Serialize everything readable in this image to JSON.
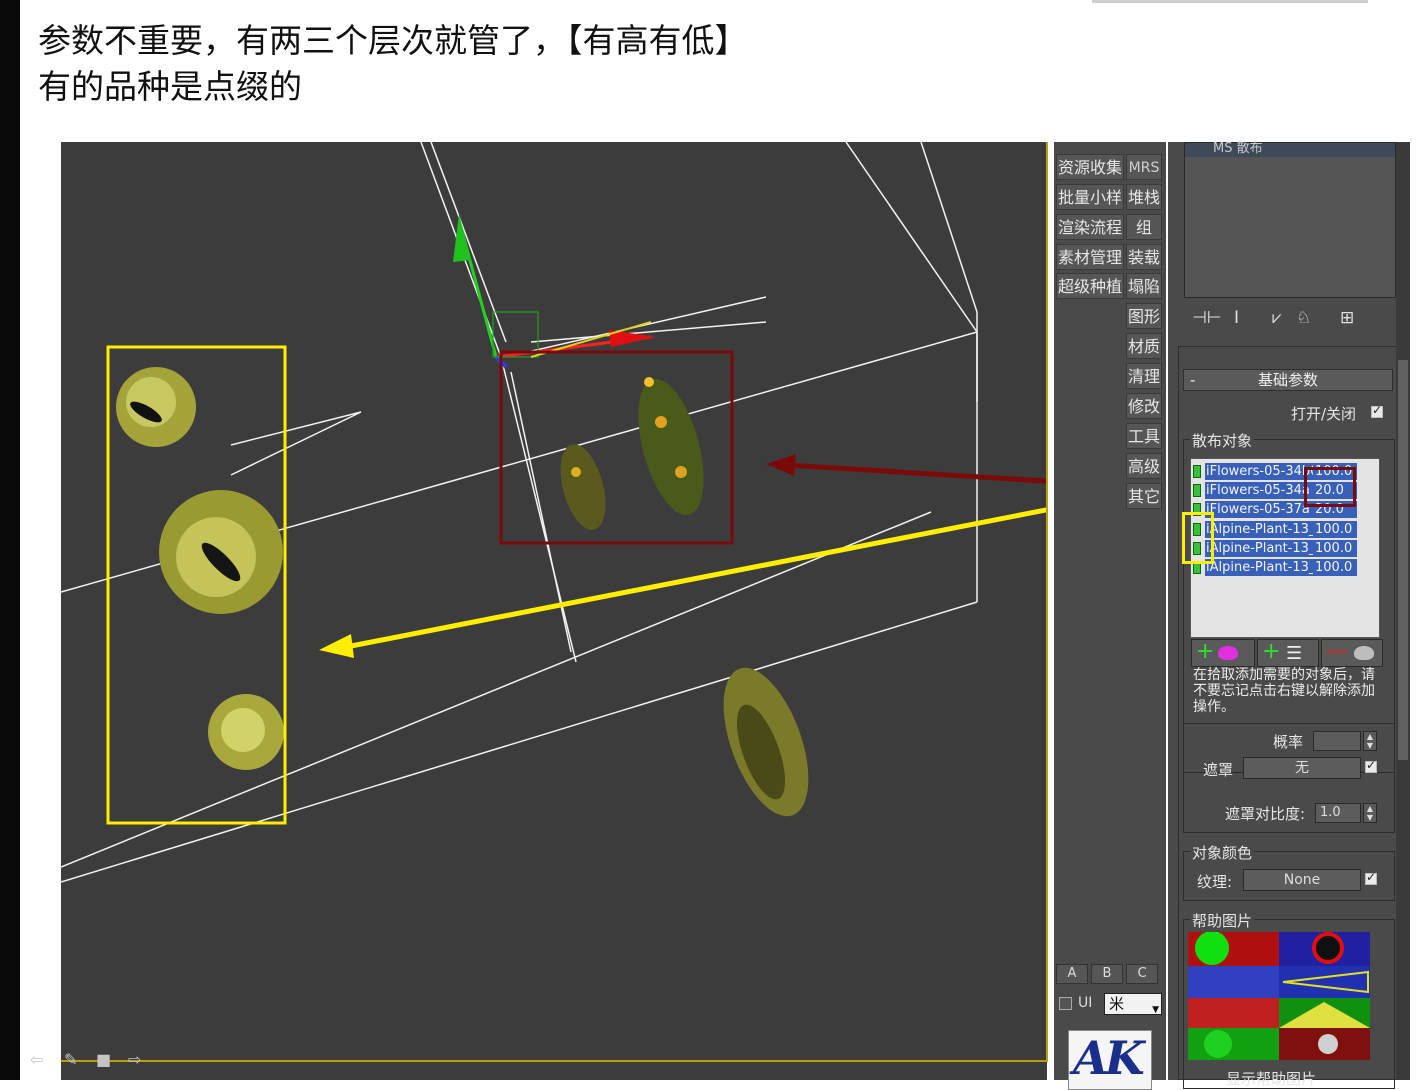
{
  "notes": {
    "line1": "参数不重要，有两三个层次就管了，【有高有低】",
    "line2": "有的品种是点缀的"
  },
  "toolbar": {
    "buttons": [
      {
        "wide": "资源收集",
        "narrow": "MRS"
      },
      {
        "wide": "批量小样",
        "narrow": "堆栈"
      },
      {
        "wide": "渲染流程",
        "narrow": "组"
      },
      {
        "wide": "素材管理",
        "narrow": "装载"
      },
      {
        "wide": "超级种植",
        "narrow": "塌陷"
      }
    ],
    "side_buttons": [
      "图形",
      "材质",
      "清理",
      "修改",
      "工具",
      "高级",
      "其它"
    ],
    "abc": [
      "A",
      "B",
      "C"
    ],
    "ui_label": "UI",
    "unit": "米",
    "logo": "AK"
  },
  "panel": {
    "modifier_item": "MS 散布",
    "rollout_title": "基础参数",
    "toggle_label": "打开/关闭",
    "scatter_group": "散布对象",
    "objects": [
      {
        "name": "iFlowers-05-34b0",
        "value": "100.0"
      },
      {
        "name": "iFlowers-05-34a",
        "value": "20.0"
      },
      {
        "name": "iFlowers-05-37a",
        "value": "20.0"
      },
      {
        "name": "iAlpine-Plant-13_",
        "value": "100.0"
      },
      {
        "name": "iAlpine-Plant-13_",
        "value": "100.0"
      },
      {
        "name": "iAlpine-Plant-13_",
        "value": "100.0"
      }
    ],
    "help_note": "在拾取添加需要的对象后，请不要忘记点击右键以解除添加操作。",
    "probability_label": "概率",
    "probability_value": "",
    "mask_label": "遮罩",
    "mask_value": "无",
    "mask_contrast_label": "遮罩对比度:",
    "mask_contrast_value": "1.0",
    "color_group": "对象颜色",
    "texture_label": "纹理:",
    "texture_value": "None",
    "help_group": "帮助图片",
    "show_help": "显示帮助图片"
  },
  "colors": {
    "viewport_bg": "#3c3c3c",
    "yellow_highlight": "#ffee00",
    "red_highlight": "#7a0a0a",
    "panel_bg": "#4a4a4a"
  }
}
